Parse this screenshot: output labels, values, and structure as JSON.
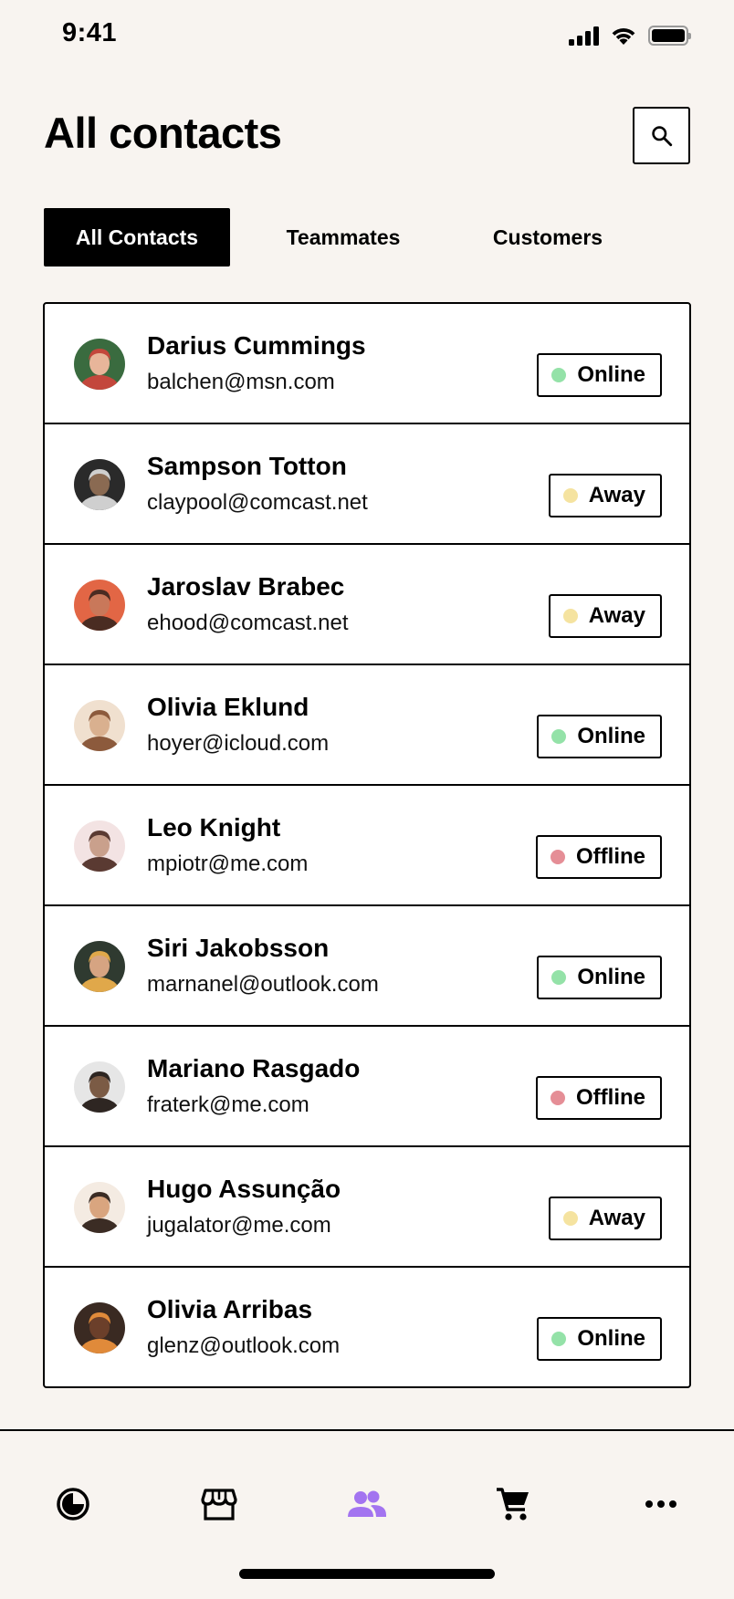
{
  "status_bar": {
    "time": "9:41"
  },
  "header": {
    "title": "All contacts",
    "search_icon": "search-icon"
  },
  "tabs": [
    {
      "label": "All Contacts",
      "active": true
    },
    {
      "label": "Teammates",
      "active": false
    },
    {
      "label": "Customers",
      "active": false
    }
  ],
  "status_colors": {
    "Online": "#94e2a8",
    "Away": "#f5e3a0",
    "Offline": "#e58e96"
  },
  "contacts": [
    {
      "name": "Darius Cummings",
      "email": "balchen@msn.com",
      "status": "Online"
    },
    {
      "name": "Sampson Totton",
      "email": "claypool@comcast.net",
      "status": "Away"
    },
    {
      "name": "Jaroslav Brabec",
      "email": "ehood@comcast.net",
      "status": "Away"
    },
    {
      "name": "Olivia Eklund",
      "email": "hoyer@icloud.com",
      "status": "Online"
    },
    {
      "name": "Leo Knight",
      "email": "mpiotr@me.com",
      "status": "Offline"
    },
    {
      "name": "Siri Jakobsson",
      "email": "marnanel@outlook.com",
      "status": "Online"
    },
    {
      "name": "Mariano Rasgado",
      "email": "fraterk@me.com",
      "status": "Offline"
    },
    {
      "name": "Hugo Assunção",
      "email": "jugalator@me.com",
      "status": "Away"
    },
    {
      "name": "Olivia Arribas",
      "email": "glenz@outlook.com",
      "status": "Online"
    }
  ],
  "tabbar": {
    "items": [
      {
        "icon": "activity-icon",
        "active": false
      },
      {
        "icon": "store-icon",
        "active": false
      },
      {
        "icon": "people-icon",
        "active": true
      },
      {
        "icon": "cart-icon",
        "active": false
      },
      {
        "icon": "more-icon",
        "active": false
      }
    ],
    "active_color": "#a374f0"
  }
}
